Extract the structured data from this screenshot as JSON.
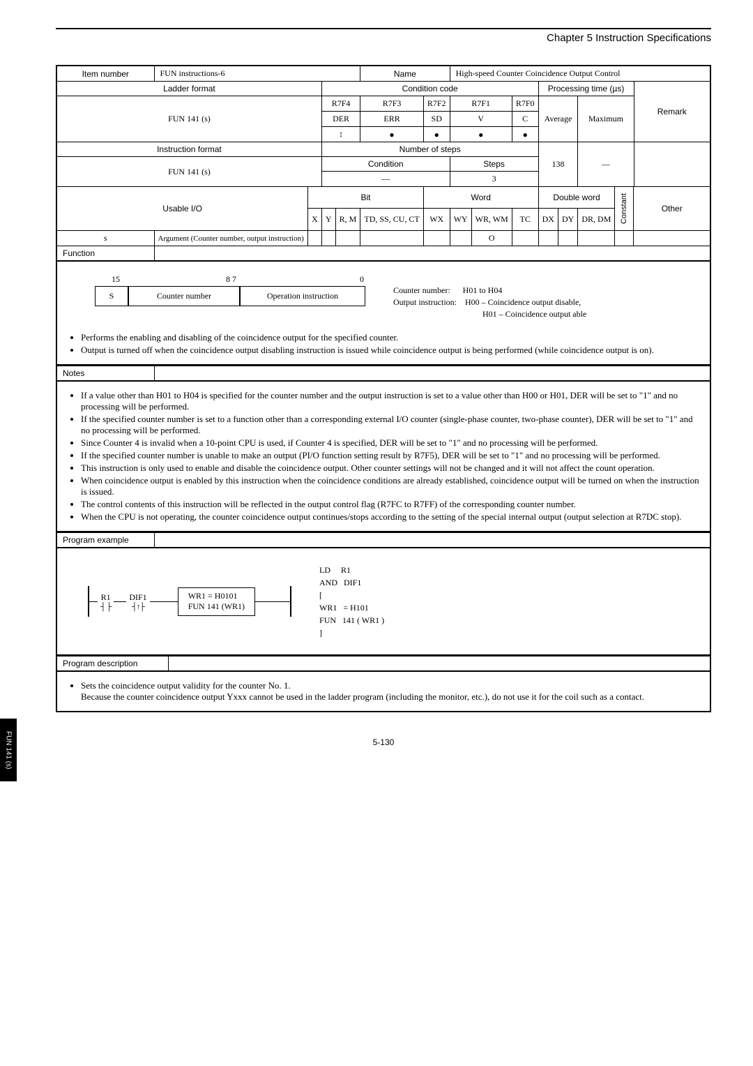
{
  "chapter": "Chapter 5  Instruction Specifications",
  "header": {
    "item_number_label": "Item number",
    "item_number_value": "FUN instructions-6",
    "name_label": "Name",
    "name_value": "High-speed Counter Coincidence Output Control",
    "ladder_format_label": "Ladder format",
    "condition_code_label": "Condition code",
    "processing_time_label": "Processing time (µs)",
    "remark_label": "Remark"
  },
  "fun_label": "FUN 141 (s)",
  "cond_cols": [
    "R7F4",
    "R7F3",
    "R7F2",
    "R7F1",
    "R7F0"
  ],
  "cond_sub": [
    "DER",
    "ERR",
    "SD",
    "V",
    "C"
  ],
  "cond_vals": [
    "↕",
    "●",
    "●",
    "●",
    "●"
  ],
  "proc_cols": {
    "average": "Average",
    "maximum": "Maximum"
  },
  "instruction_format_label": "Instruction format",
  "number_of_steps_label": "Number of steps",
  "steps_138": "138",
  "dash": "—",
  "condition_label": "Condition",
  "steps_label": "Steps",
  "steps_value": "3",
  "usable_io_label": "Usable I/O",
  "bit_label": "Bit",
  "word_label": "Word",
  "double_word_label": "Double word",
  "constant_label": "Constant",
  "other_label": "Other",
  "io_cols": [
    "X",
    "Y",
    "R, M",
    "TD, SS, CU, CT",
    "WX",
    "WY",
    "WR, WM",
    "TC",
    "DX",
    "DY",
    "DR, DM"
  ],
  "arg_s": "s",
  "arg_desc": "Argument (Counter number, output instruction)",
  "arg_mark": "O",
  "function_label": "Function",
  "counter_diagram": {
    "top_left": "15",
    "top_right": "8 7",
    "top_zero": "0",
    "cell_s": "S",
    "cell_counter": "Counter number",
    "cell_op": "Operation instruction",
    "info1": "Counter number:",
    "info1v": "H01 to H04",
    "info2": "Output instruction:",
    "info2v1": "H00 – Coincidence output disable,",
    "info2v2": "H01 – Coincidence output able"
  },
  "function_bullets": [
    "Performs the enabling and disabling of the coincidence output for the specified counter.",
    "Output is turned off when the coincidence output disabling instruction is issued while coincidence output is being performed (while coincidence output is on)."
  ],
  "notes_label": "Notes",
  "notes_bullets": [
    "If a value other than H01 to H04 is specified for the counter number and the output instruction is set to a value other than H00 or H01, DER will be set to \"1\" and no processing will be performed.",
    "If the specified counter number is set to a function other than a corresponding external I/O counter (single-phase counter, two-phase counter), DER will be set to \"1\" and no processing will be performed.",
    "Since Counter 4 is invalid when a 10-point CPU is used, if Counter 4 is specified, DER will be set to \"1\" and no processing will be performed.",
    "If the specified counter number is unable to make an output (PI/O function setting result by R7F5), DER will be set to \"1\" and no processing will be performed.",
    "This instruction is only used to enable and disable the coincidence output. Other counter settings will not be changed and it will not affect the count operation.",
    "When coincidence output is enabled by this instruction when the coincidence conditions are already established, coincidence output will be turned on when the instruction is issued.",
    "The control contents of this instruction will be reflected in the output control flag (R7FC to R7FF) of the corresponding counter number.",
    "When the CPU is not operating, the counter coincidence output continues/stops according to the setting of the special internal output (output selection at R7DC stop)."
  ],
  "program_example_label": "Program example",
  "ladder": {
    "r1": "R1",
    "dif1": "DIF1",
    "box_line1": "WR1 = H0101",
    "box_line2": "FUN 141 (WR1)",
    "code": "LD     R1\nAND   DIF1\n[\nWR1   = H101\nFUN   141 ( WR1 )\n]"
  },
  "program_description_label": "Program description",
  "program_description_bullets": [
    "Sets the coincidence output validity for the counter No. 1.\nBecause the counter coincidence output Yxxx cannot be used in the ladder program (including the monitor, etc.), do not use it for the coil such as a contact."
  ],
  "side_tab": "FUN 141 (s)",
  "page_number": "5-130"
}
